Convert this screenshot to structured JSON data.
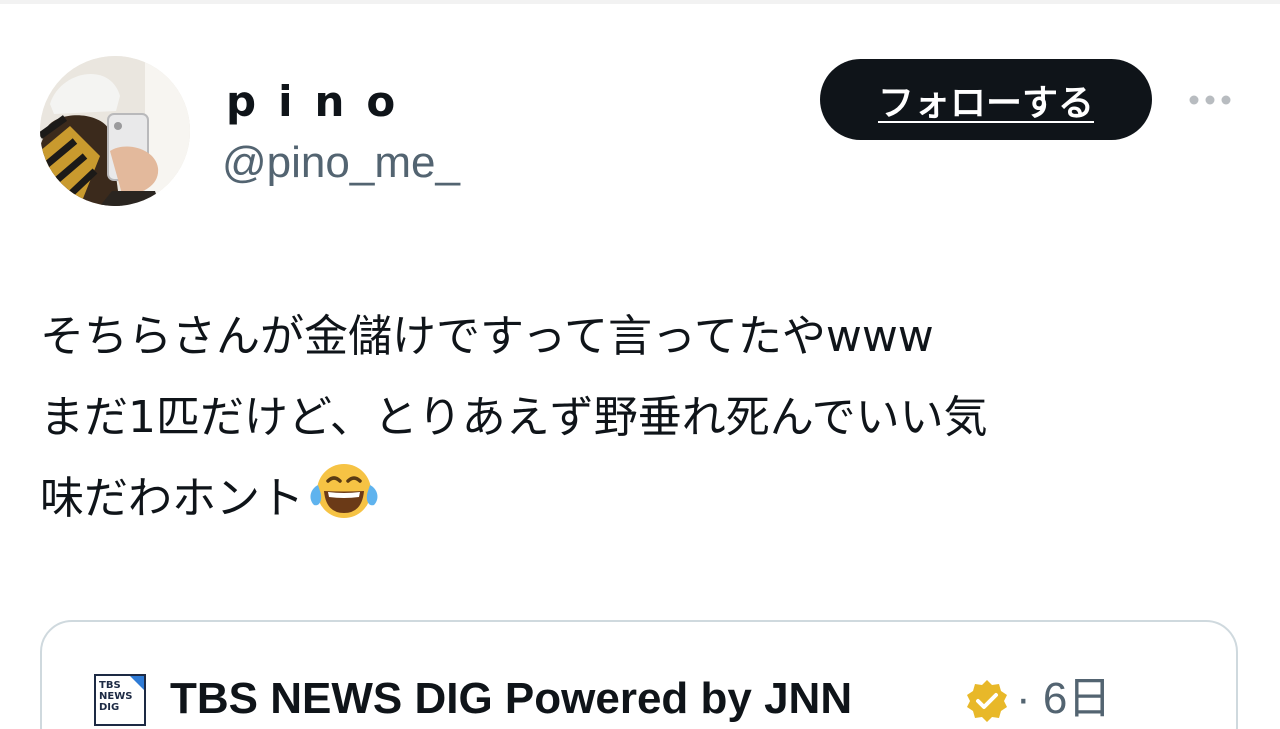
{
  "tweet": {
    "author": {
      "display_name": "pino",
      "handle": "@pino_me_"
    },
    "follow_label": "フォローする",
    "more_icon": "more-dots-icon",
    "text_lines": [
      "そちらさんが金儲けですって言ってたやwww",
      "まだ1匹だけど、とりあえず野垂れ死んでいい気",
      "味だわホント"
    ],
    "emoji": "face-with-tears-of-joy"
  },
  "quoted": {
    "source_logo_lines": [
      "TBS",
      "NEWS",
      "DIG"
    ],
    "source_name": "TBS NEWS DIG Powered by JNN",
    "verified_icon": "verified-badge-gold-icon",
    "time": "· 6日"
  },
  "colors": {
    "text": "#0f1419",
    "secondary": "#536471",
    "follow_bg": "#0f1419",
    "border": "#cfd9de",
    "verified": "#e8b829"
  }
}
